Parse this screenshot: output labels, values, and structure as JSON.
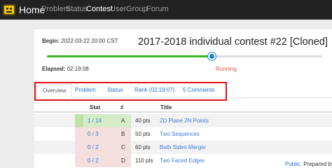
{
  "nav": {
    "brand": "Home",
    "links": [
      "Problem",
      "Status",
      "Contest",
      "User",
      "Group",
      "Forum"
    ],
    "active": "Contest"
  },
  "contest": {
    "begin_label": "Begin:",
    "begin_value": "2022-03-22 20:00 CST",
    "title": "2017-2018 individual contest #22 [Cloned]",
    "elapsed_label": "Elapsed:",
    "elapsed_value": "02:19:08",
    "status": "Running",
    "progress": 0.6
  },
  "tabs": [
    "Overview",
    "Problem",
    "Status",
    "Rank (02:19:07)",
    "5 Comments"
  ],
  "table": {
    "headers": {
      "stat": "Stat",
      "num": "#",
      "title": "Title"
    },
    "rows": [
      {
        "stat": "1 / 14",
        "num": "A",
        "pts": "40 pts",
        "title": "2D Plane 2N Points",
        "state": "solved"
      },
      {
        "stat": "0 / 3",
        "num": "B",
        "pts": "50 pts",
        "title": "Two Sequences",
        "state": "tried"
      },
      {
        "stat": "0 / 2",
        "num": "C",
        "pts": "60 pts",
        "title": "Both Sides Merger",
        "state": "tried"
      },
      {
        "stat": "0 / 2",
        "num": "D",
        "pts": "110 pts",
        "title": "Two Faced Edges",
        "state": "tried"
      }
    ]
  },
  "footer": {
    "link": "Public.",
    "text": "Prepared by"
  },
  "colors": {
    "navbar": "#222222",
    "accent_red": "#e0111b",
    "progress": "#3cb521",
    "link": "#2a6fc9"
  }
}
